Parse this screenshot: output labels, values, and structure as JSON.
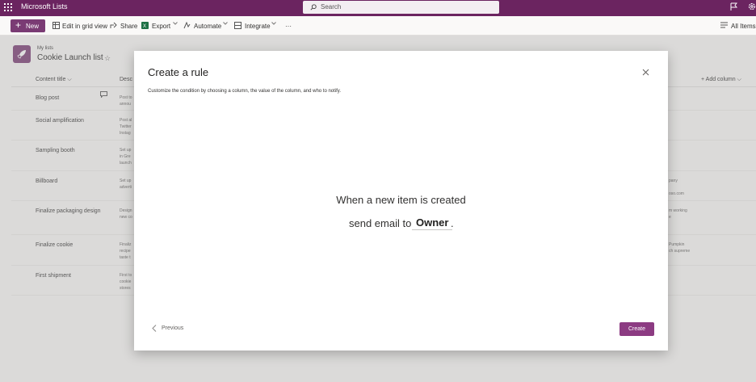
{
  "suite": {
    "app_title": "Microsoft Lists",
    "search_placeholder": "Search"
  },
  "command_bar": {
    "new_label": "New",
    "grid_view_label": "Edit in grid view",
    "share_label": "Share",
    "export_label": "Export",
    "automate_label": "Automate",
    "integrate_label": "Integrate",
    "more_label": "···",
    "view_label": "All Items"
  },
  "header": {
    "breadcrumb": "My lists",
    "title": "Cookie Launch list"
  },
  "grid": {
    "columns": {
      "title": "Content title",
      "description": "Desc",
      "add_column": "+ Add column"
    },
    "rows": [
      {
        "title": "Blog post",
        "desc": [
          "Post to",
          "annou"
        ],
        "right": []
      },
      {
        "title": "Social amplification",
        "desc": [
          "Post al",
          "Twitter",
          "Instag"
        ],
        "right": []
      },
      {
        "title": "Sampling booth",
        "desc": [
          "Set up",
          "in Gre",
          "launch"
        ],
        "right": []
      },
      {
        "title": "Billboard",
        "desc": [
          "Set up",
          "adverti"
        ],
        "right": [
          "pany",
          "",
          "oso.com"
        ]
      },
      {
        "title": "Finalize packaging design",
        "desc": [
          "Design",
          "new co"
        ],
        "right": [
          "m working",
          "e"
        ]
      },
      {
        "title": "Finalize cookie",
        "desc": [
          "Finaliz",
          "recipe",
          "taste t"
        ],
        "right": [
          "Pumpkin",
          "ch supreme"
        ]
      },
      {
        "title": "First shipment",
        "desc": [
          "First to",
          "cookie",
          "stores"
        ],
        "right": []
      }
    ]
  },
  "modal": {
    "title": "Create a rule",
    "subtitle": "Customize the condition by choosing a column, the value of the column, and who to notify.",
    "rule_when": "When a new item is created",
    "rule_action": "send email to",
    "rule_target": "Owner",
    "rule_end": ".",
    "previous_label": "Previous",
    "create_label": "Create"
  },
  "colors": {
    "suite_bar": "#6b2460",
    "accent": "#7a3b74",
    "create_button": "#8c3b82"
  }
}
